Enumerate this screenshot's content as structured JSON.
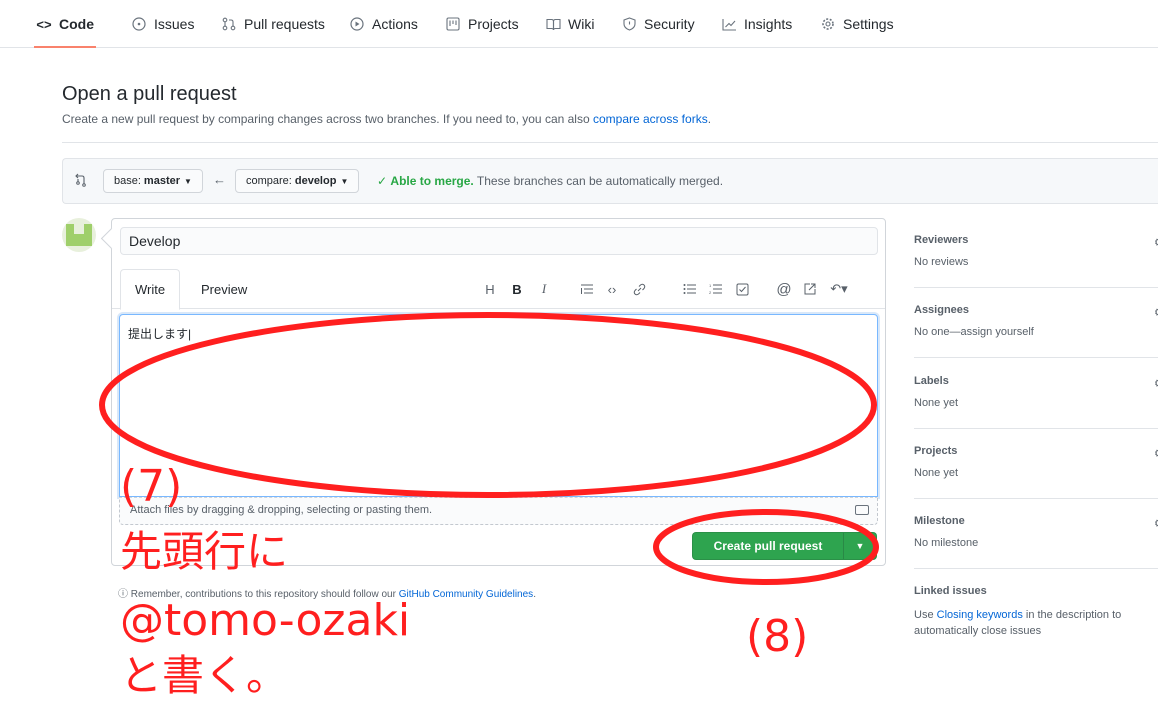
{
  "nav": {
    "tabs": [
      {
        "label": "Code",
        "icon": "code-icon",
        "active": true
      },
      {
        "label": "Issues",
        "icon": "issue-icon"
      },
      {
        "label": "Pull requests",
        "icon": "pull-request-icon"
      },
      {
        "label": "Actions",
        "icon": "play-icon"
      },
      {
        "label": "Projects",
        "icon": "project-icon"
      },
      {
        "label": "Wiki",
        "icon": "book-icon"
      },
      {
        "label": "Security",
        "icon": "shield-icon"
      },
      {
        "label": "Insights",
        "icon": "graph-icon"
      },
      {
        "label": "Settings",
        "icon": "gear-icon"
      }
    ]
  },
  "header": {
    "title": "Open a pull request",
    "desc_text": "Create a new pull request by comparing changes across two branches. If you need to, you can also ",
    "desc_link": "compare across forks",
    "desc_end": "."
  },
  "compare": {
    "base_prefix": "base:",
    "base_branch": "master",
    "compare_prefix": "compare:",
    "compare_branch": "develop",
    "status_ok": "Able to merge.",
    "status_text": "These branches can be automatically merged."
  },
  "form": {
    "title_value": "Develop",
    "tab_write": "Write",
    "tab_preview": "Preview",
    "body_value": "提出します|",
    "attach_text": "Attach files by dragging & dropping, selecting or pasting them.",
    "submit_label": "Create pull request",
    "remember_text": "Remember, contributions to this repository should follow our ",
    "remember_link": "GitHub Community Guidelines",
    "remember_end": "."
  },
  "toolbar": [
    "H",
    "B",
    "I"
  ],
  "sidebar": [
    {
      "heading": "Reviewers",
      "value": "No reviews"
    },
    {
      "heading": "Assignees",
      "value": "No one—assign yourself"
    },
    {
      "heading": "Labels",
      "value": "None yet"
    },
    {
      "heading": "Projects",
      "value": "None yet"
    },
    {
      "heading": "Milestone",
      "value": "No milestone"
    },
    {
      "heading": "Linked issues",
      "value_pre": "Use ",
      "value_link": "Closing keywords",
      "value_post": " in the description to",
      "value_line2": "automatically close issues"
    }
  ],
  "annotations": {
    "step7_num": "(7)",
    "step7_line1": "先頭行に",
    "step7_line2": "@tomo-ozaki",
    "step7_line3": "と書く。",
    "step8_num": "(8)"
  },
  "colors": {
    "annotation": "#ff1f1f",
    "primary_button": "#2ea44f",
    "link": "#0366d6",
    "merge_ok": "#28a745",
    "active_tab_underline": "#f9826c"
  }
}
